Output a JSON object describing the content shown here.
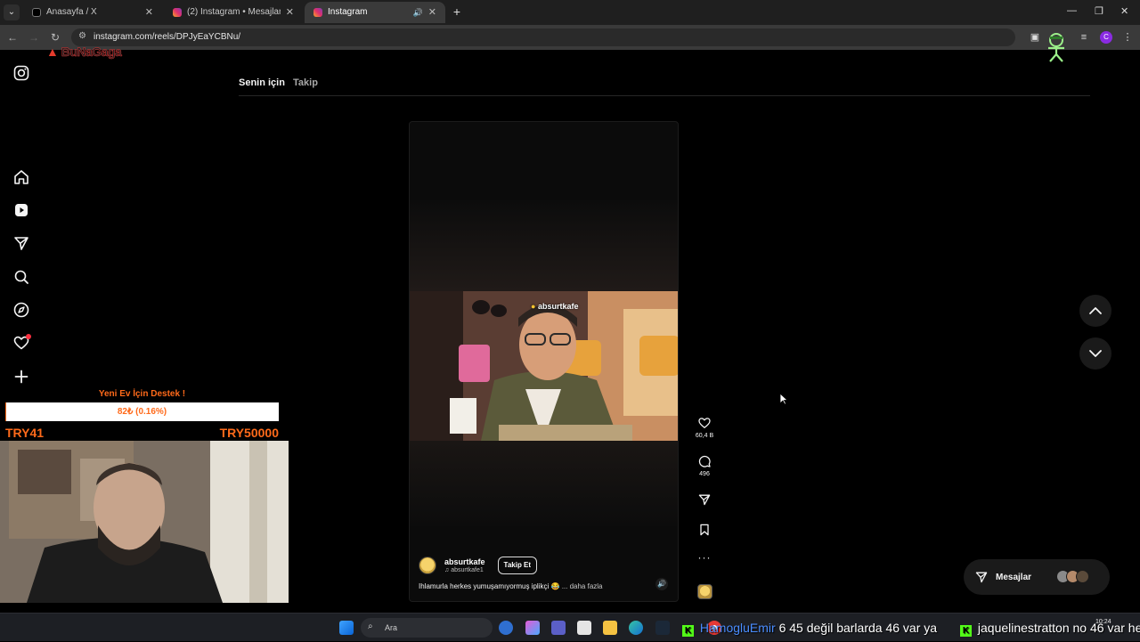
{
  "browser": {
    "tabs": [
      {
        "title": "Anasayfa / X",
        "favicon": "x-icon"
      },
      {
        "title": "(2) Instagram • Mesajlar",
        "favicon": "instagram-icon"
      },
      {
        "title": "Instagram",
        "favicon": "instagram-icon",
        "active": true,
        "audio": true
      }
    ],
    "url": "instagram.com/reels/DPJyEaYCBNu/",
    "profile_initial": "C"
  },
  "overlay": {
    "stream_logo": "BuNaGaga"
  },
  "instagram": {
    "sidebar": [
      "instagram-logo",
      "home",
      "reels",
      "messages",
      "search",
      "explore",
      "notifications",
      "create"
    ],
    "feed_tabs": [
      {
        "label": "Senin için",
        "active": true
      },
      {
        "label": "Takip",
        "active": false
      }
    ],
    "reel": {
      "watermark": "absurtkafe",
      "author_name": "absurtkafe",
      "author_audio": "absurtkafe1",
      "follow_label": "Takip Et",
      "caption": "Ihlamurla herkes yumuşamıyormuş iplikçi 😂",
      "more_label": "... daha fazla",
      "likes": "60,4 B",
      "comments": "496"
    },
    "messages_label": "Mesajlar"
  },
  "donation": {
    "title": "Yeni Ev İçin Destek !",
    "value": "82₺ (0.16%)",
    "progress_percent": 0.16,
    "min": "TRY41",
    "max": "TRY50000",
    "color": "#ff6a1a"
  },
  "taskbar": {
    "search_placeholder": "Ara",
    "ticker": [
      {
        "badge": "K",
        "user": "HamogluEmir",
        "text": "6 45 değil barlarda 46 var ya"
      },
      {
        "badge": "K",
        "user": "",
        "text": "jaquelinestratton no 46 var he"
      }
    ],
    "clock_time": "10:24"
  },
  "colors": {
    "ig_background": "#000000",
    "like_notification": "#ff3040",
    "kick_green": "#53fc18"
  }
}
